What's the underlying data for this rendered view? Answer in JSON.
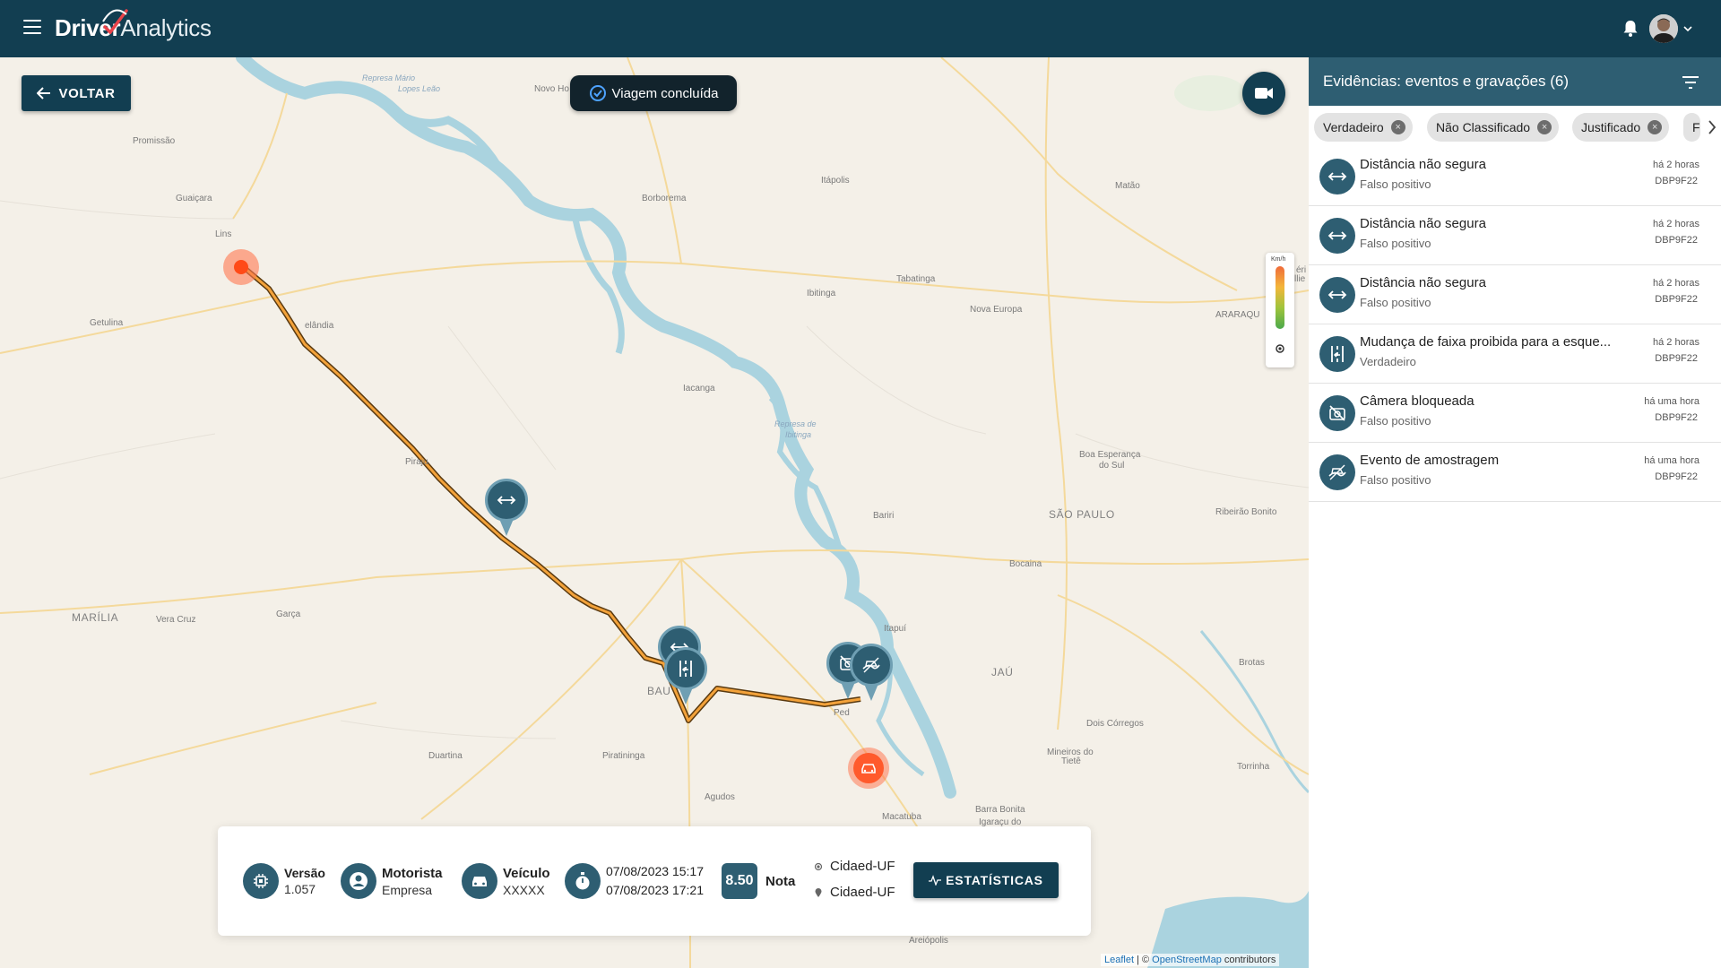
{
  "header": {
    "app_name_part1": "Dri",
    "app_name_part2": "ver",
    "app_name_part3": "Analytics",
    "brand_color": "#123e51"
  },
  "map": {
    "back_label": "VOLTAR",
    "trip_status": "Viagem concluída",
    "speed_unit": "Km/h",
    "places": {
      "promissao": "Promissão",
      "guaicara": "Guaiçara",
      "lins": "Lins",
      "getulina": "Getulina",
      "novo_ho": "Novo Ho",
      "borborema": "Borborema",
      "itapolis": "Itápolis",
      "matao": "Matão",
      "ibitinga": "Ibitinga",
      "tabatinga": "Tabatinga",
      "nova_europa": "Nova Europa",
      "araraq": "ARARAQU",
      "iacanga": "Iacanga",
      "piraju": "Piraju",
      "belandia": "elândia",
      "boa_esperanca": "Boa Esperança",
      "do_sul": "do Sul",
      "bariri": "Bariri",
      "sao_paulo": "SÃO PAULO",
      "ribeirao_bonito": "Ribeirão Bonito",
      "bocaina": "Bocaina",
      "marilia": "MARÍLIA",
      "vera_cruz": "Vera Cruz",
      "garca": "Garça",
      "itapui": "Itapuí",
      "jau": "JAÚ",
      "brotas": "Brotas",
      "bauru": "BAU",
      "pederneiras": "Ped",
      "duartina": "Duartina",
      "piratininga": "Piratininga",
      "dois_corregos": "Dois Córregos",
      "mineiros": "Mineiros do",
      "tiete": "Tietê",
      "torrinha": "Torrinha",
      "agudos": "Agudos",
      "macatuba": "Macatuba",
      "barra_bonita": "Barra Bonita",
      "igaracu": "Igaraçu do",
      "areiopolis": "Areiópolis",
      "represa1": "Represa Mário",
      "represa2": "Lopes Leão",
      "represa3": "Represa de",
      "represa4": "Ibitinga",
      "ilhas": "éri",
      "ilhas2": "llie"
    }
  },
  "trip_info": {
    "version_label": "Versão",
    "version_value": "1.057",
    "driver_label": "Motorista",
    "driver_value": "Empresa",
    "vehicle_label": "Veículo",
    "vehicle_value": "XXXXX",
    "start_time": "07/08/2023 15:17",
    "end_time": "07/08/2023 17:21",
    "score_value": "8.50",
    "score_label": "Nota",
    "origin": "Cidaed-UF",
    "destination": "Cidaed-UF",
    "stats_button": "ESTATÍSTICAS"
  },
  "attribution": {
    "leaflet": "Leaflet",
    "sep": " | © ",
    "osm": "OpenStreetMap",
    "rest": " contributors"
  },
  "panel": {
    "title": "Evidências: eventos e gravações (6)",
    "chips": [
      {
        "label": "Verdadeiro"
      },
      {
        "label": "Não Classificado"
      },
      {
        "label": "Justificado"
      },
      {
        "label": "F"
      }
    ],
    "events": [
      {
        "title": "Distância não segura",
        "status": "Falso positivo",
        "time": "há 2 horas",
        "plate": "DBP9F22",
        "icon": "distance-icon"
      },
      {
        "title": "Distância não segura",
        "status": "Falso positivo",
        "time": "há 2 horas",
        "plate": "DBP9F22",
        "icon": "distance-icon"
      },
      {
        "title": "Distância não segura",
        "status": "Falso positivo",
        "time": "há 2 horas",
        "plate": "DBP9F22",
        "icon": "distance-icon"
      },
      {
        "title": "Mudança de faixa proibida para a esque...",
        "status": "Verdadeiro",
        "time": "há 2 horas",
        "plate": "DBP9F22",
        "icon": "lane-change-icon"
      },
      {
        "title": "Câmera bloqueada",
        "status": "Falso positivo",
        "time": "há uma hora",
        "plate": "DBP9F22",
        "icon": "camera-blocked-icon"
      },
      {
        "title": "Evento de amostragem",
        "status": "Falso positivo",
        "time": "há uma hora",
        "plate": "DBP9F22",
        "icon": "sampling-icon"
      }
    ]
  }
}
